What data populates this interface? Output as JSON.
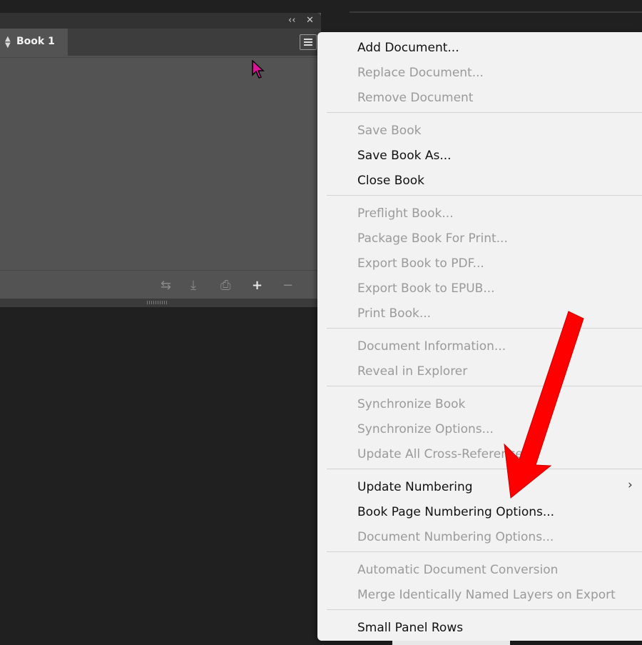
{
  "panel": {
    "tab_label": "Book 1",
    "collapse_glyph": "‹‹",
    "close_glyph": "✕",
    "bottom_icons": [
      "sync-icon",
      "save-icon",
      "print-icon",
      "add-icon",
      "remove-icon"
    ]
  },
  "menu": {
    "add_document": "Add Document...",
    "replace_document": "Replace Document...",
    "remove_document": "Remove Document",
    "save_book": "Save Book",
    "save_book_as": "Save Book As...",
    "close_book": "Close Book",
    "preflight_book": "Preflight Book...",
    "package_book": "Package Book For Print...",
    "export_pdf": "Export Book to PDF...",
    "export_epub": "Export Book to EPUB...",
    "print_book": "Print Book...",
    "document_information": "Document Information...",
    "reveal_in_explorer": "Reveal in Explorer",
    "synchronize_book": "Synchronize Book",
    "synchronize_options": "Synchronize Options...",
    "update_cross_references": "Update All Cross-References",
    "update_numbering": "Update Numbering",
    "book_page_numbering": "Book Page Numbering Options...",
    "document_numbering": "Document Numbering Options...",
    "automatic_conversion": "Automatic Document Conversion",
    "merge_layers": "Merge Identically Named Layers on Export",
    "small_panel_rows": "Small Panel Rows",
    "submenu_glyph": "›"
  },
  "colors": {
    "cursor": "#e0109a",
    "annotation_arrow": "#ff0000",
    "menu_background": "#f2f2f2",
    "panel_background": "#535353"
  }
}
